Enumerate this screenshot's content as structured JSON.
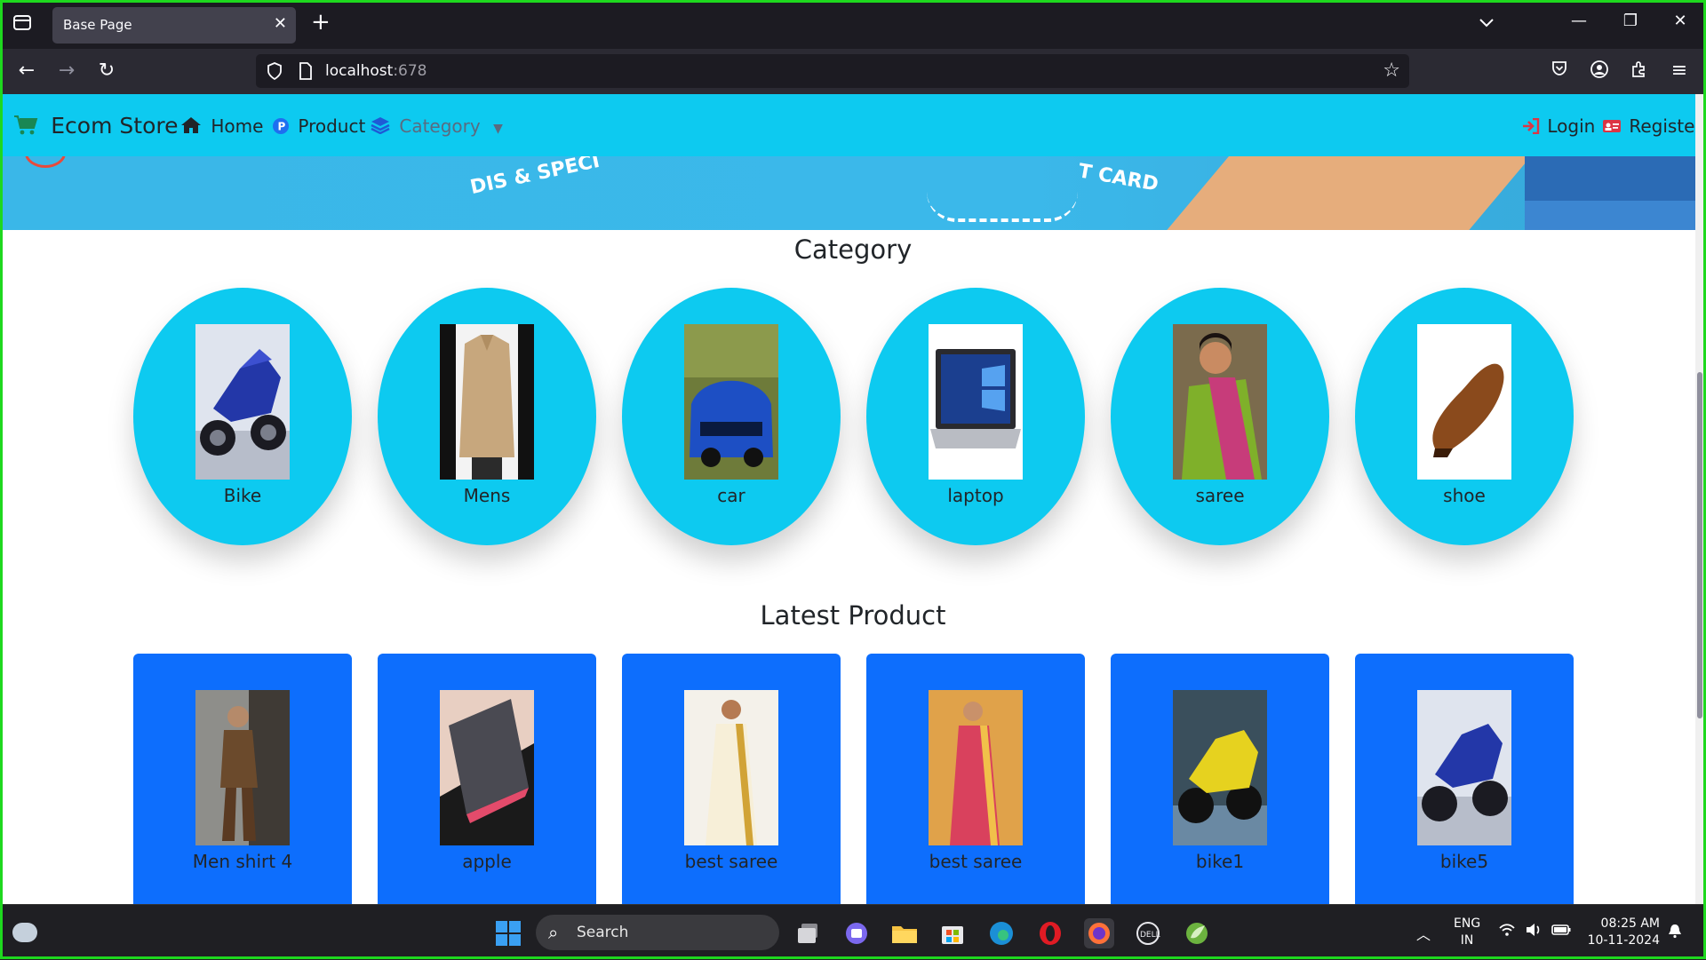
{
  "browser": {
    "tab_title": "Base Page",
    "url_host": "localhost",
    "url_port": ":678"
  },
  "site": {
    "brand": "Ecom Store",
    "nav": {
      "home": "Home",
      "product": "Product",
      "category": "Category"
    },
    "auth": {
      "login": "Login",
      "register": "Register"
    }
  },
  "banner": {
    "text_left": "DIS & SPECI",
    "text_right": "T CARD"
  },
  "category_section": {
    "title": "Category",
    "items": [
      {
        "label": "Bike",
        "icon": "motorbike-photo"
      },
      {
        "label": "Mens",
        "icon": "shirt-photo"
      },
      {
        "label": "car",
        "icon": "car-photo"
      },
      {
        "label": "laptop",
        "icon": "laptop-photo"
      },
      {
        "label": "saree",
        "icon": "saree-photo"
      },
      {
        "label": "shoe",
        "icon": "shoe-photo"
      }
    ]
  },
  "latest_section": {
    "title": "Latest Product",
    "items": [
      {
        "label": "Men shirt 4"
      },
      {
        "label": "apple"
      },
      {
        "label": "best saree"
      },
      {
        "label": "best saree"
      },
      {
        "label": "bike1"
      },
      {
        "label": "bike5"
      }
    ]
  },
  "taskbar": {
    "search_label": "Search",
    "lang_top": "ENG",
    "lang_bottom": "IN",
    "time": "08:25 AM",
    "date": "10-11-2024"
  },
  "colors": {
    "site_nav": "#0dcaf0",
    "category_card": "#0dcaf0",
    "product_card": "#0d6efd",
    "frame": "#1ed81e"
  }
}
